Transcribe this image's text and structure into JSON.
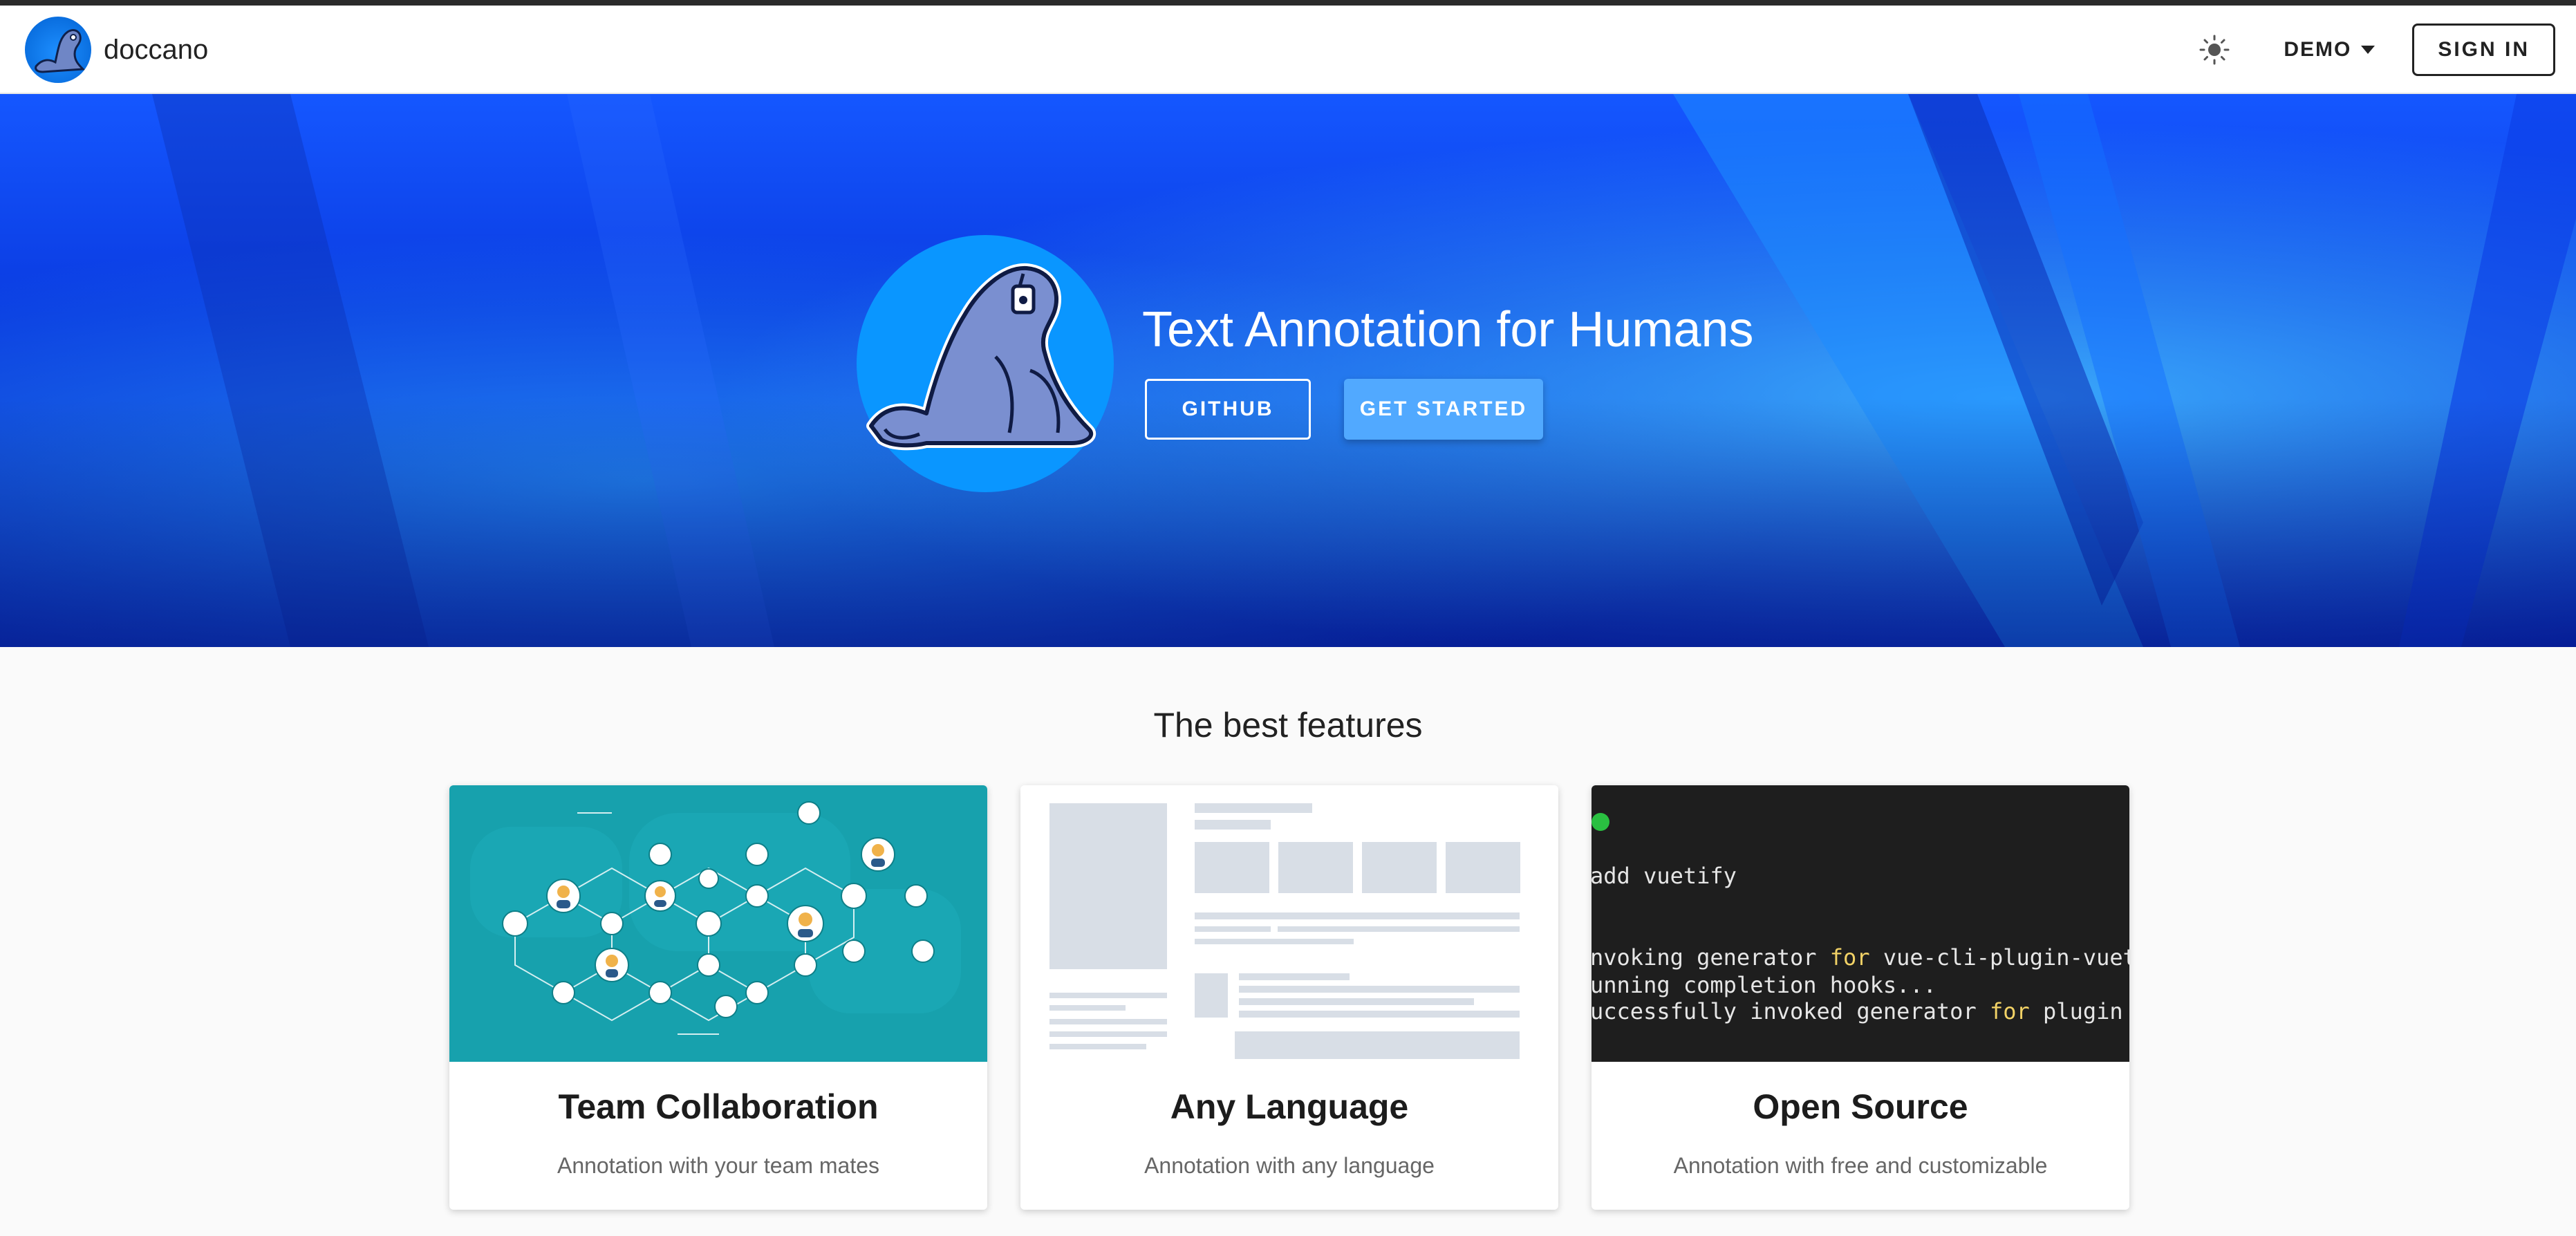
{
  "appbar": {
    "brand_name": "doccano",
    "theme_icon": "sun-icon",
    "demo_label": "DEMO",
    "signin_label": "SIGN IN"
  },
  "hero": {
    "title": "Text Annotation for Humans",
    "github_label": "GITHUB",
    "get_started_label": "GET STARTED"
  },
  "features": {
    "title": "The best features",
    "cards": [
      {
        "title": "Team Collaboration",
        "desc": "Annotation with your team mates"
      },
      {
        "title": "Any Language",
        "desc": "Annotation with any language"
      },
      {
        "title": "Open Source",
        "desc": "Annotation with free and customizable"
      }
    ],
    "terminal": {
      "line1": "add vuetify",
      "line2_a": "nvoking generator ",
      "line2_kw": "for",
      "line2_b": " vue-cli-plugin-vuetif",
      "line3": "unning completion hooks...",
      "line4_a": "uccessfully invoked generator ",
      "line4_kw": "for",
      "line4_b": " plugin"
    }
  },
  "colors": {
    "hero_blue": "#0a3ae0",
    "button_blue": "#51a9ff",
    "team_teal": "#17a1ad",
    "terminal_bg": "#1e1e1e"
  }
}
